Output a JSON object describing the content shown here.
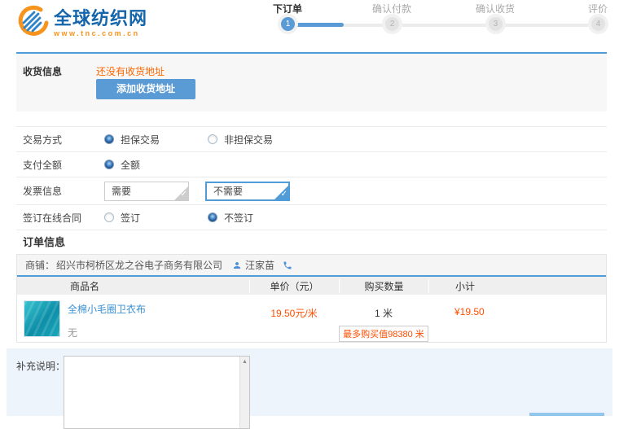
{
  "logo": {
    "title": "全球纺织网",
    "subtitle": "www.tnc.com.cn"
  },
  "steps": [
    {
      "label": "下订单",
      "number": "1",
      "active": true
    },
    {
      "label": "确认付款",
      "number": "2",
      "active": false
    },
    {
      "label": "确认收货",
      "number": "3",
      "active": false
    },
    {
      "label": "评价",
      "number": "4",
      "active": false
    }
  ],
  "shipping": {
    "section_label": "收货信息",
    "empty_message": "还没有收货地址",
    "add_address_button": "添加收货地址"
  },
  "options": {
    "rows": [
      {
        "label": "交易方式",
        "choices": [
          {
            "text": "担保交易",
            "selected": true
          },
          {
            "text": "非担保交易",
            "selected": false
          }
        ]
      },
      {
        "label": "支付全额",
        "choices": [
          {
            "text": "全额",
            "selected": true
          }
        ]
      },
      {
        "label": "发票信息",
        "boxes": [
          {
            "text": "需要",
            "selected": false
          },
          {
            "text": "不需要",
            "selected": true
          }
        ]
      },
      {
        "label": "签订在线合同",
        "choices": [
          {
            "text": "签订",
            "selected": false
          },
          {
            "text": "不签订",
            "selected": true
          }
        ]
      }
    ]
  },
  "order": {
    "section_title": "订单信息",
    "shop_label": "商铺：",
    "shop_name": "绍兴市柯桥区龙之谷电子商务有限公司",
    "contact_name": "汪家苗",
    "table": {
      "headers": [
        "商品名",
        "单价（元）",
        "购买数量",
        "小计"
      ],
      "row": {
        "product_name": "全棉小毛圈卫衣布",
        "product_spec": "无",
        "unit_price": "19.50元/米",
        "quantity": "1 米",
        "max_purchase_note": "最多购买值98380 米",
        "subtotal": "¥19.50"
      }
    }
  },
  "remarks": {
    "label": "补充说明：",
    "value": ""
  },
  "icons": {
    "check": "✓",
    "scroll_up": "▲"
  },
  "colors": {
    "accent_blue": "#4f9cd9",
    "button_blue": "#5b9bd5",
    "notice_orange": "#ff6600",
    "price_red": "#ff4e00",
    "link_blue": "#3a8fd2",
    "logo_orange": "#f7941e",
    "logo_blue": "#1565ab"
  }
}
